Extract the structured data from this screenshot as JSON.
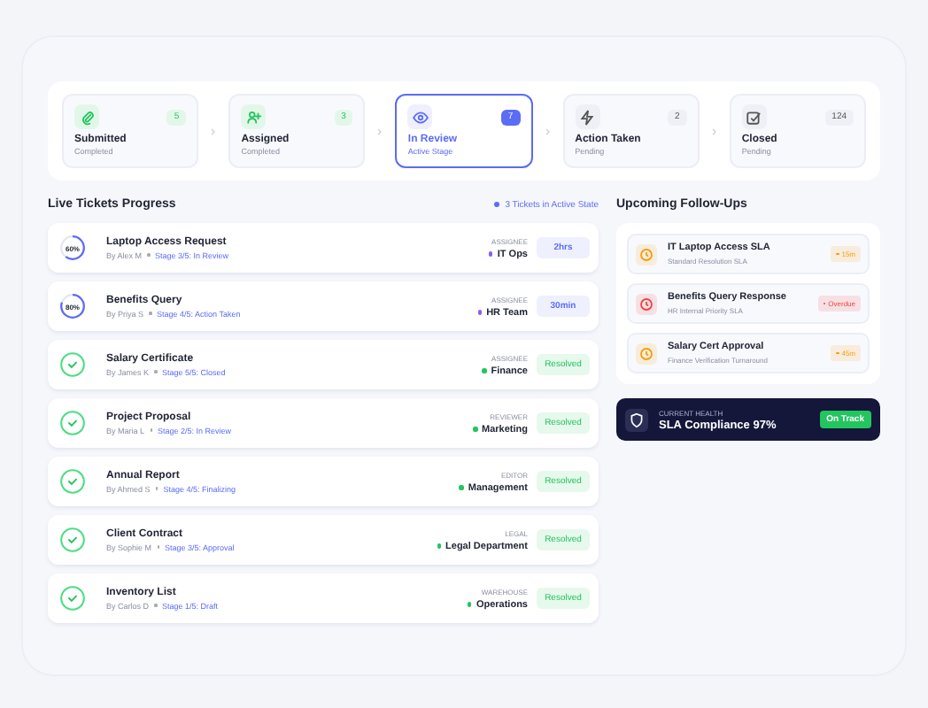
{
  "stages": [
    {
      "kind": "done",
      "count": "5",
      "title": "Submitted",
      "status": "Completed",
      "selected": false
    },
    {
      "kind": "done",
      "count": "3",
      "title": "Assigned",
      "status": "Completed",
      "selected": false
    },
    {
      "kind": "active",
      "count": "7",
      "title": "In Review",
      "status": "Active Stage",
      "selected": true
    },
    {
      "kind": "pending",
      "count": "2",
      "title": "Action Taken",
      "status": "Pending",
      "selected": false
    },
    {
      "kind": "pending",
      "count": "124",
      "title": "Closed",
      "status": "Pending",
      "selected": false
    }
  ],
  "tickets_section": {
    "title": "Live Tickets Progress",
    "active_note": "3 Tickets in Active State"
  },
  "tickets": [
    {
      "kind": "progress",
      "percent": "60%",
      "title": "Laptop Access Request",
      "author": "By Alex M",
      "stage": "Stage 3/5: In Review",
      "role": "ASSIGNEE",
      "team": "IT Ops",
      "color": "#8b5cf6",
      "badge": "2hrs"
    },
    {
      "kind": "progress",
      "percent": "80%",
      "title": "Benefits Query",
      "author": "By Priya S",
      "stage": "Stage 4/5: Action Taken",
      "role": "ASSIGNEE",
      "team": "HR Team",
      "color": "#8b5cf6",
      "badge": "30min"
    },
    {
      "kind": "done",
      "title": "Salary Certificate",
      "author": "By James K",
      "stage": "Stage 5/5: Closed",
      "role": "ASSIGNEE",
      "team": "Finance",
      "color": "#22c55e",
      "badge": "Resolved"
    },
    {
      "kind": "done",
      "title": "Project Proposal",
      "author": "By Maria L",
      "stage": "Stage 2/5: In Review",
      "role": "REVIEWER",
      "team": "Marketing",
      "color": "#22c55e",
      "badge": "Resolved"
    },
    {
      "kind": "done",
      "title": "Annual Report",
      "author": "By Ahmed S",
      "stage": "Stage 4/5: Finalizing",
      "role": "EDITOR",
      "team": "Management",
      "color": "#22c55e",
      "badge": "Resolved"
    },
    {
      "kind": "done",
      "title": "Client Contract",
      "author": "By Sophie M",
      "stage": "Stage 3/5: Approval",
      "role": "LEGAL",
      "team": "Legal Department",
      "color": "#22c55e",
      "badge": "Resolved"
    },
    {
      "kind": "done",
      "title": "Inventory List",
      "author": "By Carlos D",
      "stage": "Stage 1/5: Draft",
      "role": "WAREHOUSE",
      "team": "Operations",
      "color": "#22c55e",
      "badge": "Resolved"
    }
  ],
  "followups_title": "Upcoming Follow-Ups",
  "followups": [
    {
      "title": "IT Laptop Access SLA",
      "subtitle": "Standard Resolution SLA",
      "tag": "15m",
      "color": "#f59e0b"
    },
    {
      "title": "Benefits Query Response",
      "subtitle": "HR Internal Priority SLA",
      "tag": "Overdue",
      "color": "#ef4444"
    },
    {
      "title": "Salary Cert Approval",
      "subtitle": "Finance Verification Turnaround",
      "tag": "45m",
      "color": "#f59e0b"
    }
  ],
  "health": {
    "label": "CURRENT HEALTH",
    "value": "SLA Compliance 97%",
    "status": "On Track"
  }
}
